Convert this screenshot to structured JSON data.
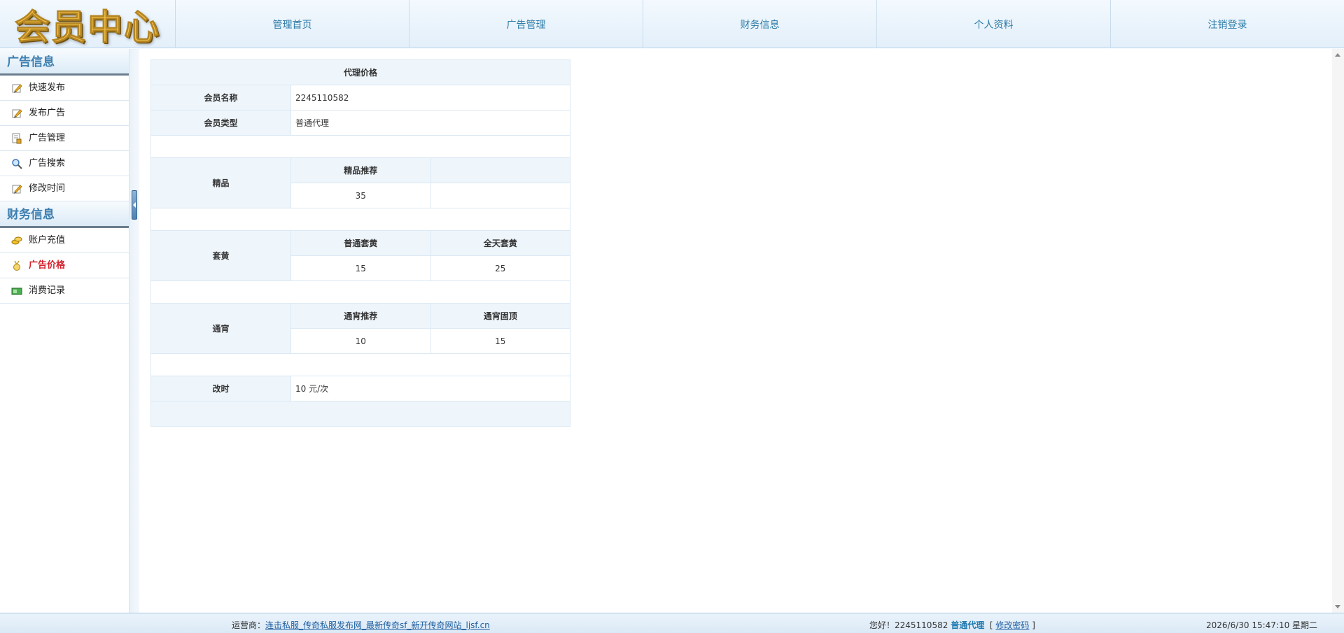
{
  "logo": {
    "text": "会员中心"
  },
  "topnav": [
    "管理首页",
    "广告管理",
    "财务信息",
    "个人资料",
    "注销登录"
  ],
  "sidebar": {
    "sections": [
      {
        "title": "广告信息",
        "items": [
          {
            "label": "快速发布",
            "icon": "pencil-icon"
          },
          {
            "label": "发布广告",
            "icon": "pencil-icon"
          },
          {
            "label": "广告管理",
            "icon": "document-icon"
          },
          {
            "label": "广告搜索",
            "icon": "search-icon"
          },
          {
            "label": "修改时间",
            "icon": "pencil-icon"
          }
        ]
      },
      {
        "title": "财务信息",
        "items": [
          {
            "label": "账户充值",
            "icon": "coins-icon"
          },
          {
            "label": "广告价格",
            "icon": "medal-icon",
            "active": true
          },
          {
            "label": "消费记录",
            "icon": "money-icon"
          }
        ]
      }
    ]
  },
  "table": {
    "title": "代理价格",
    "member_name_label": "会员名称",
    "member_name": "2245110582",
    "member_type_label": "会员类型",
    "member_type": "普通代理",
    "jingpin": {
      "label": "精品",
      "headers": [
        "精品推荐",
        ""
      ],
      "values": [
        "35",
        ""
      ]
    },
    "taohong": {
      "label": "套黄",
      "headers": [
        "普通套黄",
        "全天套黄"
      ],
      "values": [
        "15",
        "25"
      ]
    },
    "tongxiao": {
      "label": "通宵",
      "headers": [
        "通宵推荐",
        "通宵固顶"
      ],
      "values": [
        "10",
        "15"
      ]
    },
    "gaishi": {
      "label": "改时",
      "value": "10 元/次"
    }
  },
  "statusbar": {
    "operator_label": "运营商：",
    "operator_link": "连击私服_传奇私服发布网_最新传奇sf_新开传奇网站_ljsf.cn",
    "greeting": "您好！2245110582",
    "role": "普通代理",
    "bracket_open": "[",
    "change_password": "修改密码",
    "bracket_close": "]",
    "datetime": "2026/6/30 15:47:10 星期二"
  },
  "colors": {
    "accent": "#2c7ba7",
    "active": "#d4202a",
    "header_bg": "#eef5fb"
  }
}
